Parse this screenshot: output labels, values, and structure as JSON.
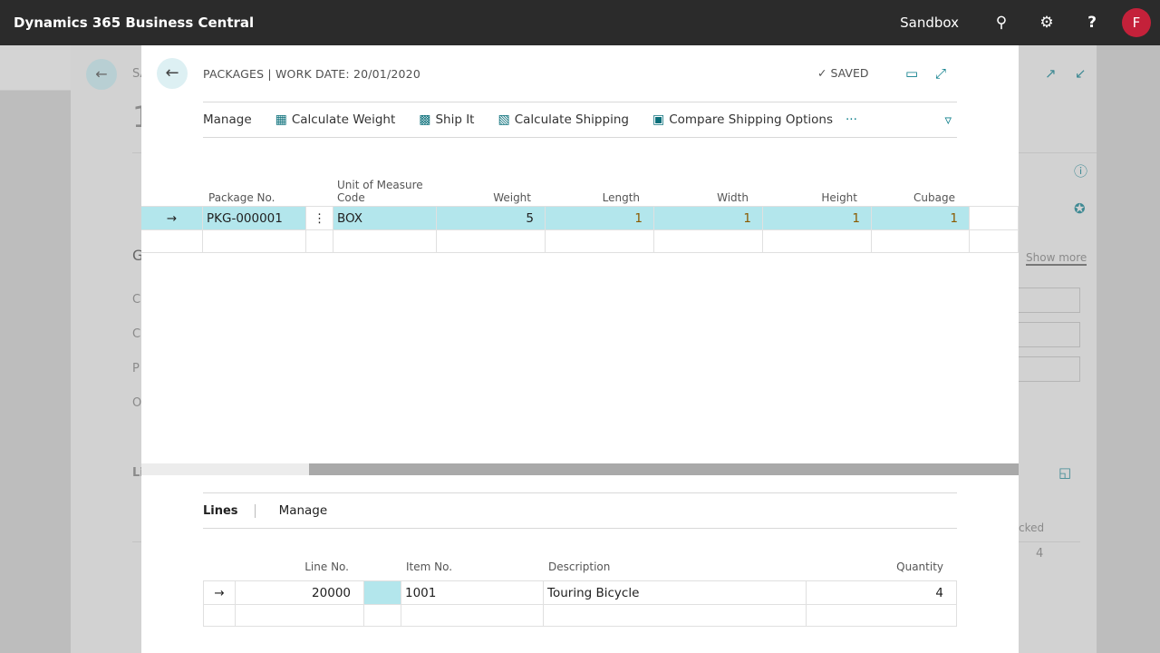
{
  "app": {
    "title": "Dynamics 365 Business Central",
    "environment": "Sandbox",
    "avatar_initial": "F",
    "icons": [
      "search-icon",
      "gear-icon",
      "help-icon"
    ]
  },
  "background_page": {
    "caption": "SA",
    "number": "1",
    "section_g": "G",
    "fields": [
      "C",
      "C",
      "P",
      "O"
    ],
    "lines": "Li",
    "show_more": "Show more",
    "qty_header": "cked",
    "qty_value": "4"
  },
  "dialog": {
    "title": "PACKAGES | WORK DATE: 20/01/2020",
    "status": "SAVED",
    "actions": [
      {
        "label": "Manage",
        "icon": ""
      },
      {
        "label": "Calculate Weight",
        "icon": "calculator-icon"
      },
      {
        "label": "Ship It",
        "icon": "ship-icon"
      },
      {
        "label": "Calculate Shipping",
        "icon": "shipping-calc-icon"
      },
      {
        "label": "Compare Shipping Options",
        "icon": "compare-icon"
      }
    ],
    "more": "···",
    "packages": {
      "columns": [
        "Package No.",
        "Unit of Measure Code",
        "Weight",
        "Length",
        "Width",
        "Height",
        "Cubage"
      ],
      "rows": [
        {
          "package_no": "PKG-000001",
          "uom": "BOX",
          "weight": "5",
          "length": "1",
          "width": "1",
          "height": "1",
          "cubage": "1"
        }
      ]
    },
    "lines_tabs": [
      "Lines",
      "Manage"
    ],
    "lines": {
      "columns": [
        "Line No.",
        "Item No.",
        "Description",
        "Quantity"
      ],
      "rows": [
        {
          "line_no": "20000",
          "item_no": "1001",
          "description": "Touring Bicycle",
          "quantity": "4"
        }
      ]
    }
  },
  "colors": {
    "accent": "#0a7d8a",
    "selected_row": "#b3e6ec",
    "topbar": "#2b2b2b",
    "avatar": "#c4213a"
  }
}
